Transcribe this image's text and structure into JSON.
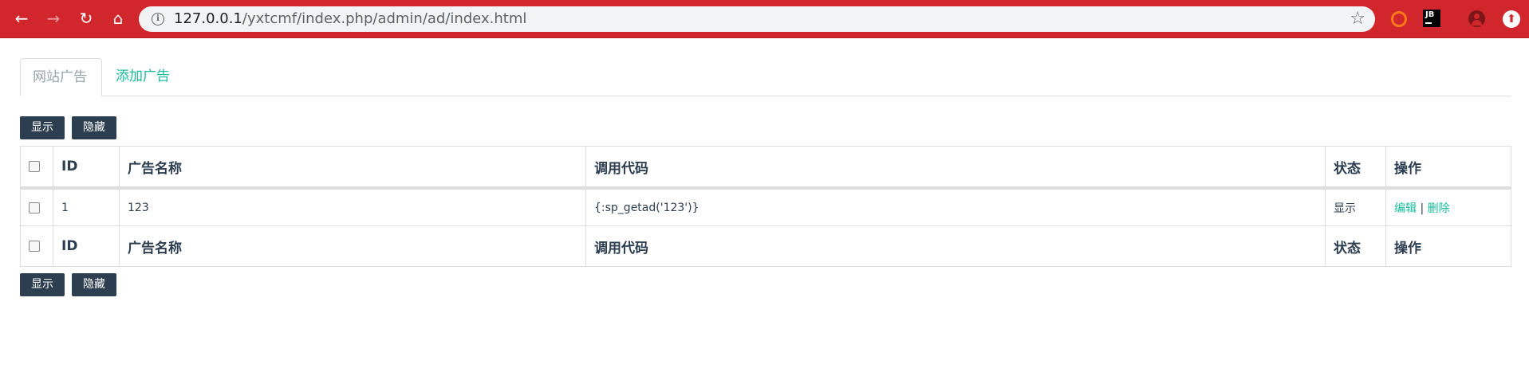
{
  "browser": {
    "url_host": "127.0.0.1",
    "url_path": "/yxtcmf/index.php/admin/ad/index.html",
    "extension_jb_label": "JB",
    "colors": {
      "toolbar": "#d1262c"
    }
  },
  "tabs": [
    {
      "label": "网站广告",
      "active": true
    },
    {
      "label": "添加广告",
      "active": false
    }
  ],
  "actions": {
    "show_label": "显示",
    "hide_label": "隐藏"
  },
  "table": {
    "headers": {
      "id": "ID",
      "name": "广告名称",
      "code": "调用代码",
      "status": "状态",
      "ops": "操作"
    },
    "rows": [
      {
        "id": "1",
        "name": "123",
        "code": "{:sp_getad('123')}",
        "status": "显示",
        "edit": "编辑",
        "separator": "|",
        "delete": "删除"
      }
    ]
  },
  "theme": {
    "primary": "#2c3e50",
    "link": "#18bc9c"
  }
}
